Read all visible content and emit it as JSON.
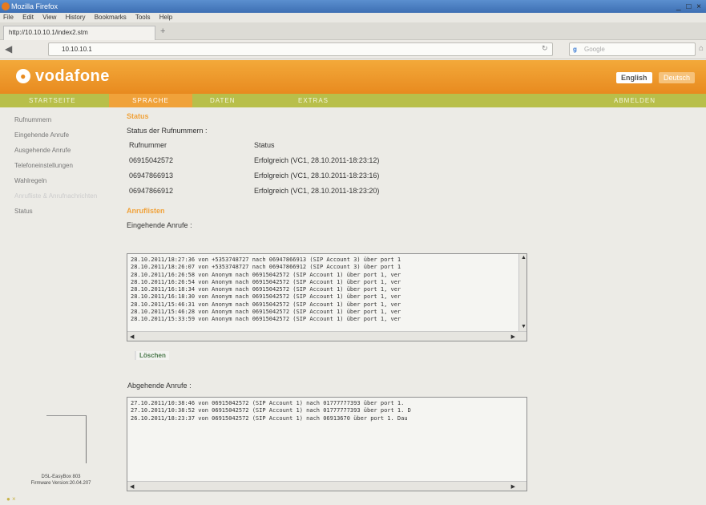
{
  "browser": {
    "window_title": "Mozilla Firefox",
    "window_controls": "_ □ ×",
    "menu": [
      "File",
      "Edit",
      "View",
      "History",
      "Bookmarks",
      "Tools",
      "Help"
    ],
    "tab_title": "http://10.10.10.1/index2.stm",
    "new_tab": "+",
    "url": "10.10.10.1",
    "search_placeholder": "Google",
    "status_icon": "● ×"
  },
  "header": {
    "brand": "vodafone",
    "lang_english": "English",
    "lang_deutsch": "Deutsch"
  },
  "nav": [
    "STARTSEITE",
    "SPRACHE",
    "DATEN",
    "EXTRAS",
    "ABMELDEN"
  ],
  "sidebar": {
    "items": [
      {
        "label": "Rufnummern",
        "enabled": true
      },
      {
        "label": "Eingehende Anrufe",
        "enabled": true
      },
      {
        "label": "Ausgehende Anrufe",
        "enabled": true
      },
      {
        "label": "Telefoneinstellungen",
        "enabled": true
      },
      {
        "label": "Wahlregeln",
        "enabled": true
      },
      {
        "label": "Anrufliste & Anrufnachrichten",
        "enabled": false
      },
      {
        "label": "Status",
        "enabled": true
      }
    ],
    "device_name": "DSL-EasyBox 803",
    "firmware": "Firmware Version:20.04.207"
  },
  "status_section": {
    "title": "Status",
    "subtitle": "Status der Rufnummern :",
    "columns": [
      "Rufnummer",
      "Status"
    ],
    "rows": [
      {
        "number": "06915042572",
        "status": "Erfolgreich (VC1, 28.10.2011-18:23:12)"
      },
      {
        "number": "06947866913",
        "status": "Erfolgreich (VC1, 28.10.2011-18:23:16)"
      },
      {
        "number": "06947866912",
        "status": "Erfolgreich (VC1, 28.10.2011-18:23:20)"
      }
    ]
  },
  "calls_section": {
    "title": "Anruflisten",
    "incoming_label": "Eingehende Anrufe :",
    "incoming_log": [
      "28.10.2011/18:27:36 von +5353748727 nach 06947866913 (SIP Account 3) über port 1",
      "28.10.2011/18:26:07 von +5353748727 nach 06947866912 (SIP Account 3) über port 1",
      "28.10.2011/16:26:58 von Anonym nach 06915042572 (SIP Account 1) über port 1, ver",
      "28.10.2011/16:26:54 von Anonym nach 06915042572 (SIP Account 1) über port 1, ver",
      "28.10.2011/16:18:34 von Anonym nach 06915042572 (SIP Account 1) über port 1, ver",
      "28.10.2011/16:18:30 von Anonym nach 06915042572 (SIP Account 1) über port 1, ver",
      "28.10.2011/15:46:31 von Anonym nach 06915042572 (SIP Account 1) über port 1, ver",
      "28.10.2011/15:46:28 von Anonym nach 06915042572 (SIP Account 1) über port 1, ver",
      "28.10.2011/15:33:59 von Anonym nach 06915042572 (SIP Account 1) über port 1, ver"
    ],
    "delete_button": "Löschen",
    "outgoing_label": "Abgehende Anrufe :",
    "outgoing_log": [
      "27.10.2011/10:38:46 von 06915042572 (SIP Account 1) nach 01777777393 über port 1.",
      "27.10.2011/10:38:52 von 06915042572 (SIP Account 1) nach 01777777393 über port 1. D",
      "26.10.2011/18:23:37 von 06915042572 (SIP Account 1) nach 06913670 über port 1. Dau"
    ]
  }
}
